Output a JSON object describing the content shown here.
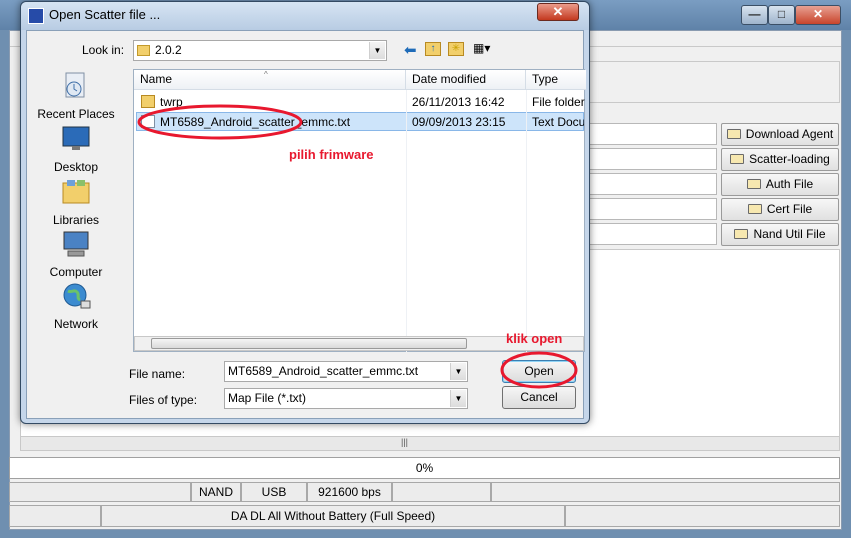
{
  "main_window": {
    "title": "",
    "window_buttons": {
      "minimize": "—",
      "maximize": "□",
      "close": "✕"
    },
    "scatter_buttons": [
      "Download Agent",
      "Scatter-loading",
      "Auth File",
      "Cert File",
      "Nand Util File"
    ],
    "progress_text": "0%",
    "status_bar": {
      "storage": "NAND",
      "port": "USB",
      "baud": "921600 bps",
      "mode": "DA DL All Without Battery (Full Speed)"
    },
    "scroll_grip": "|||"
  },
  "dialog": {
    "title": "Open Scatter file ...",
    "close_label": "✕",
    "look_in_label": "Look in:",
    "look_in_value": "2.0.2",
    "places": [
      "Recent Places",
      "Desktop",
      "Libraries",
      "Computer",
      "Network"
    ],
    "columns": {
      "name": "Name",
      "date": "Date modified",
      "type": "Type"
    },
    "files": [
      {
        "name": "twrp",
        "date": "26/11/2013 16:42",
        "type": "File folder",
        "kind": "folder"
      },
      {
        "name": "MT6589_Android_scatter_emmc.txt",
        "date": "09/09/2013 23:15",
        "type": "Text Docu",
        "kind": "text"
      }
    ],
    "file_name_label": "File name:",
    "file_name_value": "MT6589_Android_scatter_emmc.txt",
    "file_type_label": "Files of type:",
    "file_type_value": "Map File (*.txt)",
    "open_label": "Open",
    "cancel_label": "Cancel"
  },
  "annotations": {
    "pick": "pilih frimware",
    "open": "klik open"
  },
  "colors": {
    "annotation": "#e8182e",
    "selection": "#cde4fa"
  }
}
